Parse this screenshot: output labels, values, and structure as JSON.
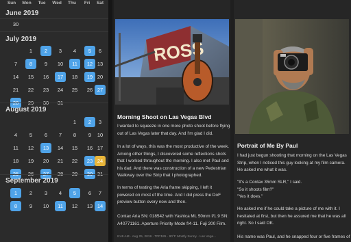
{
  "weekdays": [
    "Sun",
    "Mon",
    "Tue",
    "Wed",
    "Thu",
    "Fri",
    "Sat"
  ],
  "months": [
    {
      "title": "June 2019"
    },
    {
      "title": "July 2019"
    },
    {
      "title": "August 2019"
    },
    {
      "title": "September 2019"
    }
  ],
  "june_days": [
    "30"
  ],
  "july_days": [
    "1",
    "2",
    "3",
    "4",
    "5",
    "6",
    "7",
    "8",
    "9",
    "10",
    "11",
    "12",
    "13",
    "14",
    "15",
    "16",
    "17",
    "18",
    "19",
    "20",
    "21",
    "22",
    "23",
    "24",
    "25",
    "26",
    "27",
    "28",
    "29",
    "30",
    "31"
  ],
  "august_days": [
    "1",
    "2",
    "3",
    "4",
    "5",
    "6",
    "7",
    "8",
    "9",
    "10",
    "11",
    "12",
    "13",
    "14",
    "15",
    "16",
    "17",
    "18",
    "19",
    "20",
    "21",
    "22",
    "23",
    "24",
    "25",
    "26",
    "27",
    "28",
    "29",
    "30",
    "31"
  ],
  "september_days": [
    "1",
    "2",
    "3",
    "4",
    "5",
    "6",
    "7",
    "8",
    "9",
    "10",
    "11",
    "12",
    "13",
    "14"
  ],
  "post1": {
    "title": "Morning Shoot on Las Vegas Blvd",
    "p1": [
      "I wanted to squeeze in one more photo shoot before flying",
      "out of Las Vegas later that day. And I'm glad I did."
    ],
    "p2": [
      "In a lot of ways, this was the most productive of the week.",
      "Among other things, I discovered some reflections shots",
      "that I worked throughout the morning. I also met Paul and",
      "his dad. And there was construction of a new Pedestrian",
      "Walkway over the Strip that I photographed."
    ],
    "p3": [
      "In terms of testing the Aria frame skipping, I left it",
      "powered on most of the time. And I did press the DoF",
      "preview button every now and then."
    ],
    "p4": [
      "Contax Aria SN: 018542 with Yashica ML 50mm f/1.9 SN:",
      "A40771161. Aperture Priority Mode f/4-11. Fuji 200 Film."
    ],
    "meta": "8:46 AM · Aug 25, 2019 · TFP185 · 90°F Mostly Sunny · Las Vega..."
  },
  "post2": {
    "title": "Portrait of Me By Paul",
    "p1": [
      "I had just begun shooting that morning on the Las Vegas",
      "Strip, when I noticed this guy looking at my film camera.",
      "He asked me what it was."
    ],
    "p2": [
      "\"It's a Contax 35mm SLR,\" I said.",
      "\"So it shoots film?\"",
      "\"Yes it does.\""
    ],
    "p3": [
      "He asked me if he could take a picture of me with it. I",
      "hesitated at first, but then he assured me that he was all",
      "right. So I said OK."
    ],
    "p4": [
      "His name was Paul, and he snapped four or five frames of"
    ]
  },
  "photo1_sign": "ROSS",
  "colors": {
    "accent_blue": "#4fa3e8",
    "accent_yellow": "#e8b53a",
    "background": "#1f1f1f",
    "panel": "#262626"
  }
}
